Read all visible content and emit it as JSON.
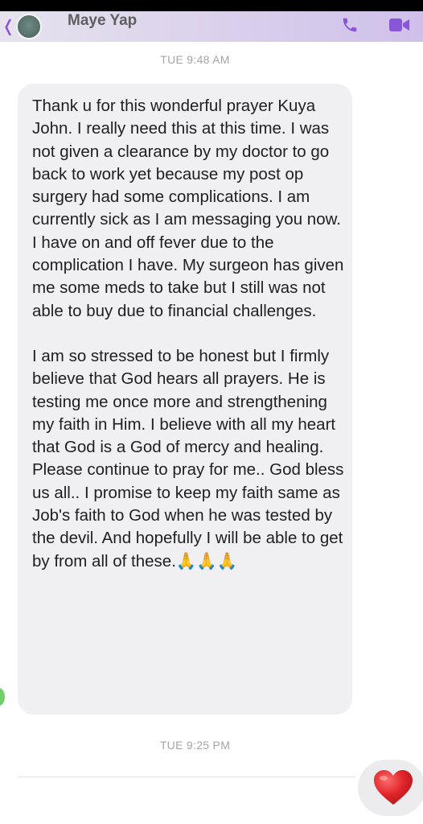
{
  "header": {
    "contact_name": "Maye Yap",
    "back_icon": "chevron-left-icon",
    "call_icon": "phone-icon",
    "video_icon": "video-camera-icon",
    "accent_color": "#8a55d8"
  },
  "conversation": {
    "timestamp_top": "TUE 9:48 AM",
    "message": {
      "paragraphs": [
        "Thank u for this wonderful prayer Kuya John. I really need this at this time. I was not given a clearance by my doctor to go back to work yet because my post op surgery had some complications. I am currently sick as I am messaging you now. I have on and off fever due to the complication I have. My surgeon has given me some meds to take but I still was not able to buy due to financial challenges.",
        "I am so stressed to be honest but I firmly believe that God hears all prayers. He is testing me once more and strengthening my faith in Him. I believe with all my heart that God is a God of mercy and healing. Please continue to pray for me.. God bless us all.. I promise to keep my faith same as Job's faith to God when he was tested by the devil. And hopefully I will be able to get by from all of these.🙏🙏🙏"
      ],
      "bubble_color": "#f0f0f2"
    },
    "timestamp_bottom": "TUE 9:25 PM",
    "reaction": {
      "icon": "red-heart-icon",
      "color": "#e0262b"
    }
  }
}
